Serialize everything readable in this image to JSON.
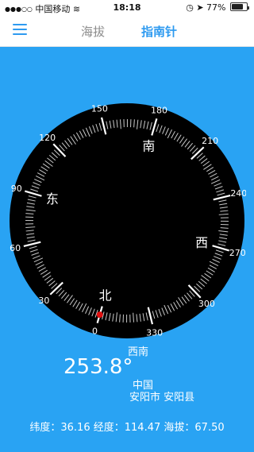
{
  "status_bar": {
    "carrier": "中国移动",
    "time": "18:18",
    "battery": "77%",
    "battery_level": 0.77
  },
  "navbar": {
    "tabs": [
      {
        "label": "海拔",
        "active": false
      },
      {
        "label": "指南针",
        "active": true
      }
    ]
  },
  "compass": {
    "degree_labels": [
      "0",
      "30",
      "60",
      "90",
      "120",
      "150",
      "180",
      "210",
      "240",
      "270",
      "300",
      "330"
    ],
    "cardinals": {
      "north": "北",
      "west": "西",
      "south": "南",
      "east": "东"
    },
    "heading_deg": 253.8,
    "colors": {
      "dial": "#000000",
      "ticks": "#ffffff",
      "pointer": "#e01010",
      "background": "#29a3f3"
    }
  },
  "info": {
    "direction": "西南",
    "heading": "253.8°",
    "country": "中国",
    "locality": "安阳市 安阳县"
  },
  "footer": {
    "lat_label": "纬度：",
    "lat_value": "36.16",
    "lon_label": "经度：",
    "lon_value": "114.47",
    "alt_label": "海拔：",
    "alt_value": "67.50"
  }
}
